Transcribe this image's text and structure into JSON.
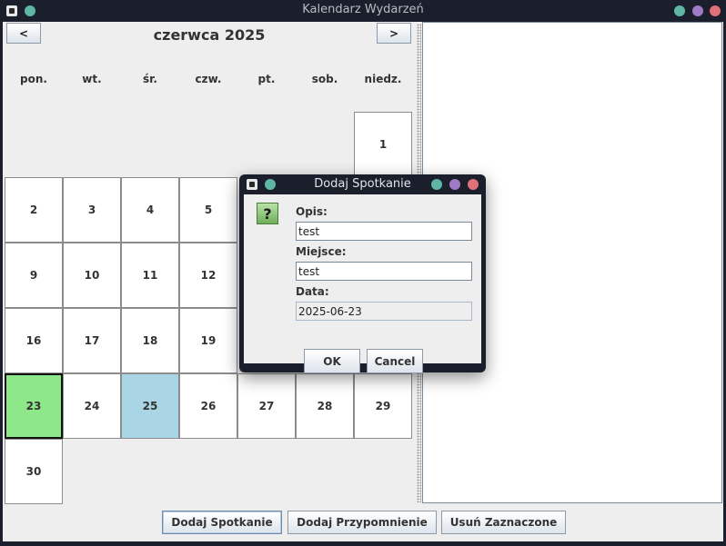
{
  "window": {
    "title": "Kalendarz Wydarzeń"
  },
  "calendar": {
    "prev_label": "<",
    "next_label": ">",
    "month_title": "czerwca 2025",
    "weekdays": [
      "pon.",
      "wt.",
      "śr.",
      "czw.",
      "pt.",
      "sob.",
      "niedz."
    ],
    "days": [
      "1",
      "2",
      "3",
      "4",
      "5",
      "9",
      "10",
      "11",
      "12",
      "16",
      "17",
      "18",
      "19",
      "23",
      "24",
      "25",
      "26",
      "27",
      "28",
      "29",
      "30"
    ],
    "selected_day": "23",
    "highlighted_day": "25"
  },
  "buttons": {
    "add_meeting": "Dodaj Spotkanie",
    "add_reminder": "Dodaj Przypomnienie",
    "remove_selected": "Usuń Zaznaczone"
  },
  "dialog": {
    "title": "Dodaj Spotkanie",
    "icon": "question-icon",
    "icon_glyph": "?",
    "description_label": "Opis:",
    "description_value": "test",
    "place_label": "Miejsce:",
    "place_value": "test",
    "date_label": "Data:",
    "date_value": "2025-06-23",
    "ok_label": "OK",
    "cancel_label": "Cancel"
  },
  "colors": {
    "titlebar": "#1b1f2b",
    "selected_day": "#8ee88a",
    "highlighted_day": "#a9d5e4",
    "question_icon": "#6fae5a"
  }
}
